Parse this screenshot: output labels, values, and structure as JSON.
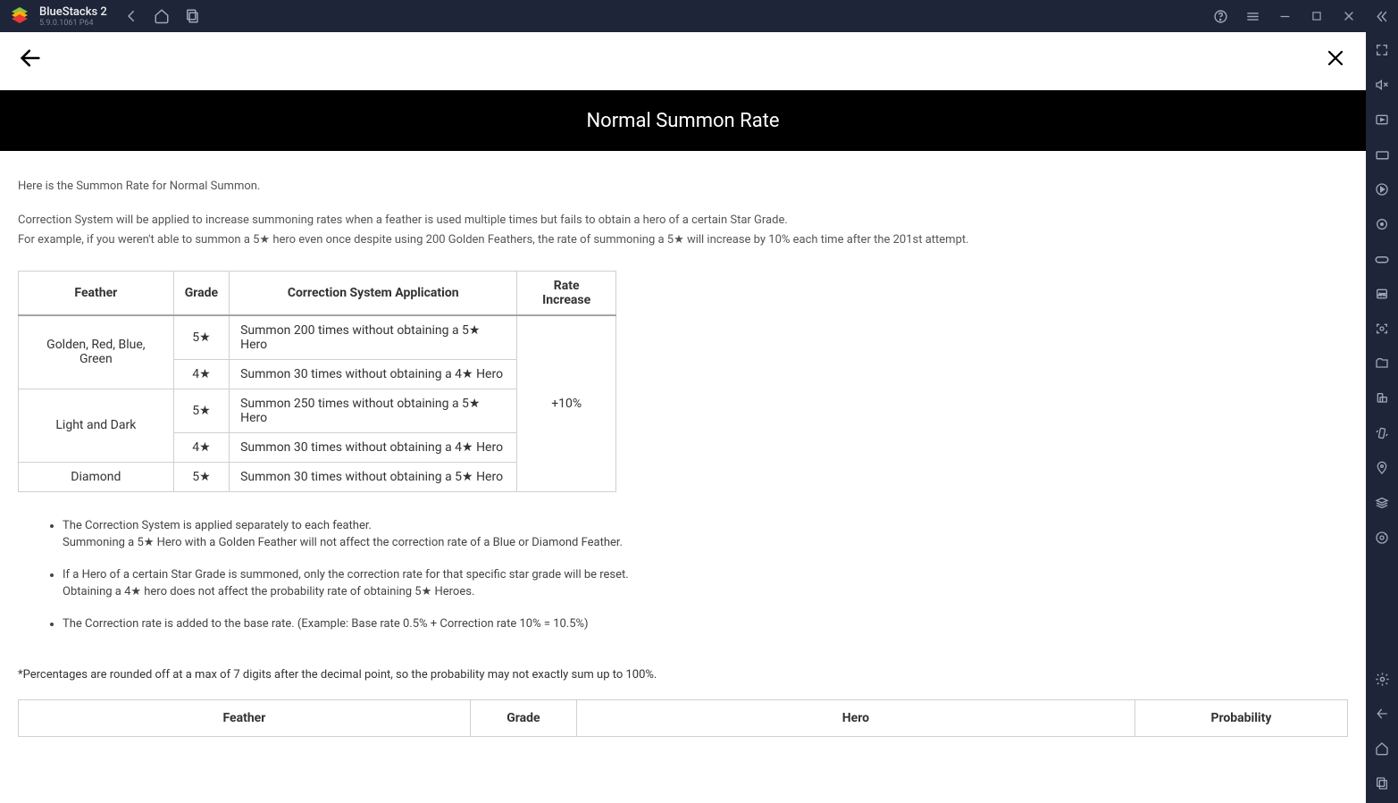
{
  "titlebar": {
    "app_name": "BlueStacks 2",
    "version": "5.9.0.1061 P64"
  },
  "app": {
    "banner_title": "Normal Summon Rate",
    "intro": "Here is the Summon Rate for Normal Summon.",
    "desc1": "Correction System will be applied to increase summoning rates when a feather is used multiple times but fails to obtain a hero of a certain Star Grade.",
    "desc2": "For example, if you weren't able to summon a 5★ hero even once despite using 200 Golden Feathers, the rate of summoning a 5★ will increase by 10% each time after the 201st attempt."
  },
  "correction_table": {
    "headers": {
      "feather": "Feather",
      "grade": "Grade",
      "application": "Correction System Application",
      "rate": "Rate Increase"
    },
    "rows": [
      {
        "feather": "Golden, Red, Blue, Green",
        "feather_rowspan": 2,
        "grade": "5★",
        "application": "Summon 200 times without obtaining a 5★ Hero"
      },
      {
        "grade": "4★",
        "application": "Summon 30 times without obtaining a 4★ Hero"
      },
      {
        "feather": "Light and Dark",
        "feather_rowspan": 2,
        "grade": "5★",
        "application": "Summon 250 times without obtaining a 5★ Hero"
      },
      {
        "grade": "4★",
        "application": "Summon 30 times without obtaining a 4★ Hero"
      },
      {
        "feather": "Diamond",
        "feather_rowspan": 1,
        "grade": "5★",
        "application": "Summon 30 times without obtaining a 5★ Hero"
      }
    ],
    "rate_value": "+10%"
  },
  "bullets": {
    "b1a": "The Correction System is applied separately to each feather.",
    "b1b": "Summoning a 5★ Hero with a Golden Feather will not affect the correction rate of a Blue or Diamond Feather.",
    "b2a": "If a Hero of a certain Star Grade is summoned, only the correction rate for that specific star grade will be reset.",
    "b2b": "Obtaining a 4★ hero does not affect the probability rate of obtaining 5★ Heroes.",
    "b3": "The Correction rate is added to the base rate. (Example: Base rate 0.5% + Correction rate 10% = 10.5%)"
  },
  "footnote": "*Percentages are rounded off at a max of 7 digits after the decimal point, so the probability may not exactly sum up to 100%.",
  "rates_table": {
    "headers": {
      "feather": "Feather",
      "grade": "Grade",
      "hero": "Hero",
      "probability": "Probability"
    }
  }
}
